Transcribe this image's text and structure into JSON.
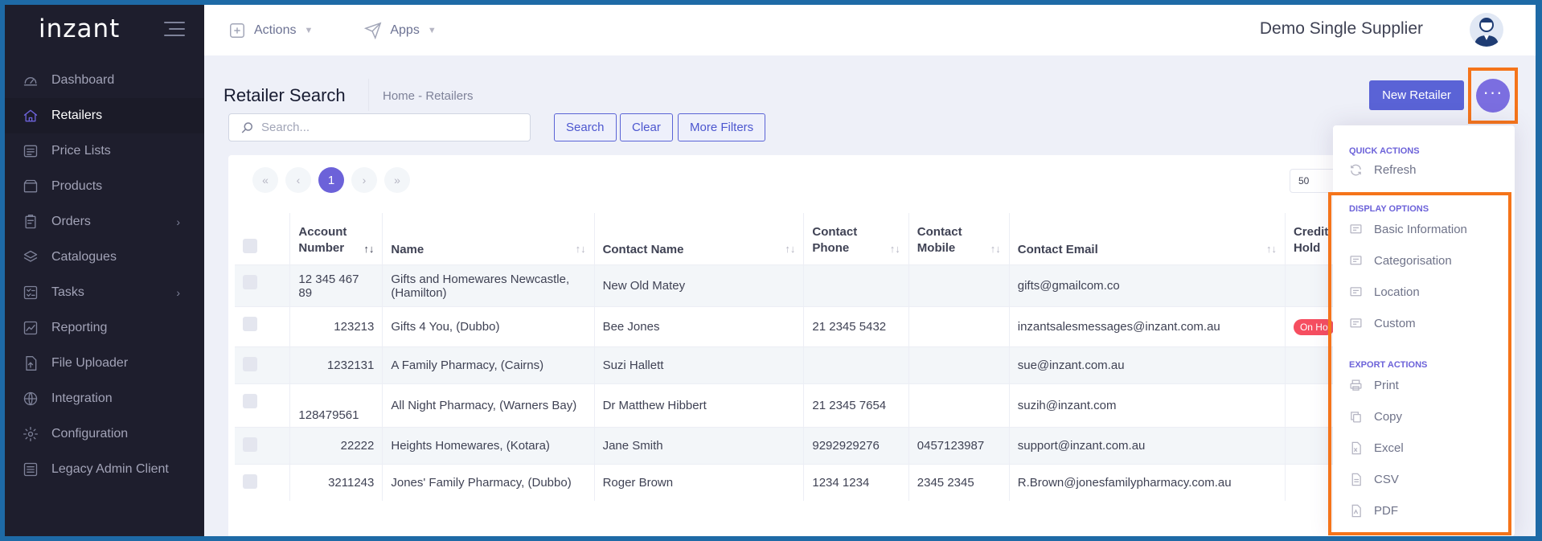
{
  "brand": {
    "logo": "inzant"
  },
  "sidebar": {
    "items": [
      {
        "label": "Dashboard",
        "icon": "gauge-icon",
        "active": false,
        "has_children": false
      },
      {
        "label": "Retailers",
        "icon": "home-icon",
        "active": true,
        "has_children": false
      },
      {
        "label": "Price Lists",
        "icon": "tag-list-icon",
        "active": false,
        "has_children": false
      },
      {
        "label": "Products",
        "icon": "box-icon",
        "active": false,
        "has_children": false
      },
      {
        "label": "Orders",
        "icon": "clipboard-icon",
        "active": false,
        "has_children": true
      },
      {
        "label": "Catalogues",
        "icon": "layers-icon",
        "active": false,
        "has_children": false
      },
      {
        "label": "Tasks",
        "icon": "tasks-icon",
        "active": false,
        "has_children": true
      },
      {
        "label": "Reporting",
        "icon": "chart-icon",
        "active": false,
        "has_children": false
      },
      {
        "label": "File Uploader",
        "icon": "file-upload-icon",
        "active": false,
        "has_children": false
      },
      {
        "label": "Integration",
        "icon": "globe-icon",
        "active": false,
        "has_children": false
      },
      {
        "label": "Configuration",
        "icon": "gear-icon",
        "active": false,
        "has_children": false
      },
      {
        "label": "Legacy Admin Client",
        "icon": "list-icon",
        "active": false,
        "has_children": false
      }
    ]
  },
  "header": {
    "actions_label": "Actions",
    "apps_label": "Apps",
    "user_name": "Demo Single Supplier"
  },
  "subheader": {
    "title": "Retailer Search",
    "breadcrumb": "Home  -  Retailers",
    "search_placeholder": "Search...",
    "search_btn": "Search",
    "clear_btn": "Clear",
    "more_filters_btn": "More Filters",
    "new_retailer_btn": "New Retailer",
    "more_btn": "···"
  },
  "pager": {
    "first": "«",
    "prev": "‹",
    "current": "1",
    "next": "›",
    "last": "»",
    "page_size": "50"
  },
  "table": {
    "headers": {
      "account": "Account Number",
      "name": "Name",
      "contact_name": "Contact Name",
      "contact_phone": "Contact Phone",
      "contact_mobile": "Contact Mobile",
      "contact_email": "Contact Email",
      "credit_hold": "Credit Hold"
    },
    "rows": [
      {
        "account": "12 345 467 89",
        "name": "Gifts and Homewares Newcastle, (Hamilton)",
        "contact_name": "New Old Matey",
        "phone": "",
        "mobile": "",
        "email": "gifts@gmailcom.co",
        "hold": ""
      },
      {
        "account": "123213",
        "name": "Gifts 4 You, (Dubbo)",
        "contact_name": "Bee Jones",
        "phone": "21 2345 5432",
        "mobile": "",
        "email": "inzantsalesmessages@inzant.com.au",
        "hold": "On Ho"
      },
      {
        "account": "1232131",
        "name": "A Family Pharmacy, (Cairns)",
        "contact_name": "Suzi Hallett",
        "phone": "",
        "mobile": "",
        "email": "sue@inzant.com.au",
        "hold": ""
      },
      {
        "account": "128479561",
        "name": "All Night Pharmacy, (Warners Bay)",
        "contact_name": "Dr Matthew Hibbert",
        "phone": "21 2345 7654",
        "mobile": "",
        "email": "suzih@inzant.com",
        "hold": ""
      },
      {
        "account": "22222",
        "name": "Heights Homewares, (Kotara)",
        "contact_name": "Jane Smith",
        "phone": "9292929276",
        "mobile": "0457123987",
        "email": "support@inzant.com.au",
        "hold": ""
      },
      {
        "account": "3211243",
        "name": "Jones' Family Pharmacy, (Dubbo)",
        "contact_name": "Roger Brown",
        "phone": "1234 1234",
        "mobile": "2345 2345",
        "email": "R.Brown@jonesfamilypharmacy.com.au",
        "hold": ""
      }
    ]
  },
  "dropdown": {
    "quick_actions": "QUICK ACTIONS",
    "refresh": "Refresh",
    "display_options": "DISPLAY OPTIONS",
    "basic_information": "Basic Information",
    "categorisation": "Categorisation",
    "location": "Location",
    "custom": "Custom",
    "export_actions": "EXPORT ACTIONS",
    "print": "Print",
    "copy": "Copy",
    "excel": "Excel",
    "csv": "CSV",
    "pdf": "PDF"
  },
  "colors": {
    "accent": "#5a63d6",
    "sidebar_bg": "#1e1e2d",
    "highlight": "#f5741a",
    "badge": "#f64e60"
  }
}
